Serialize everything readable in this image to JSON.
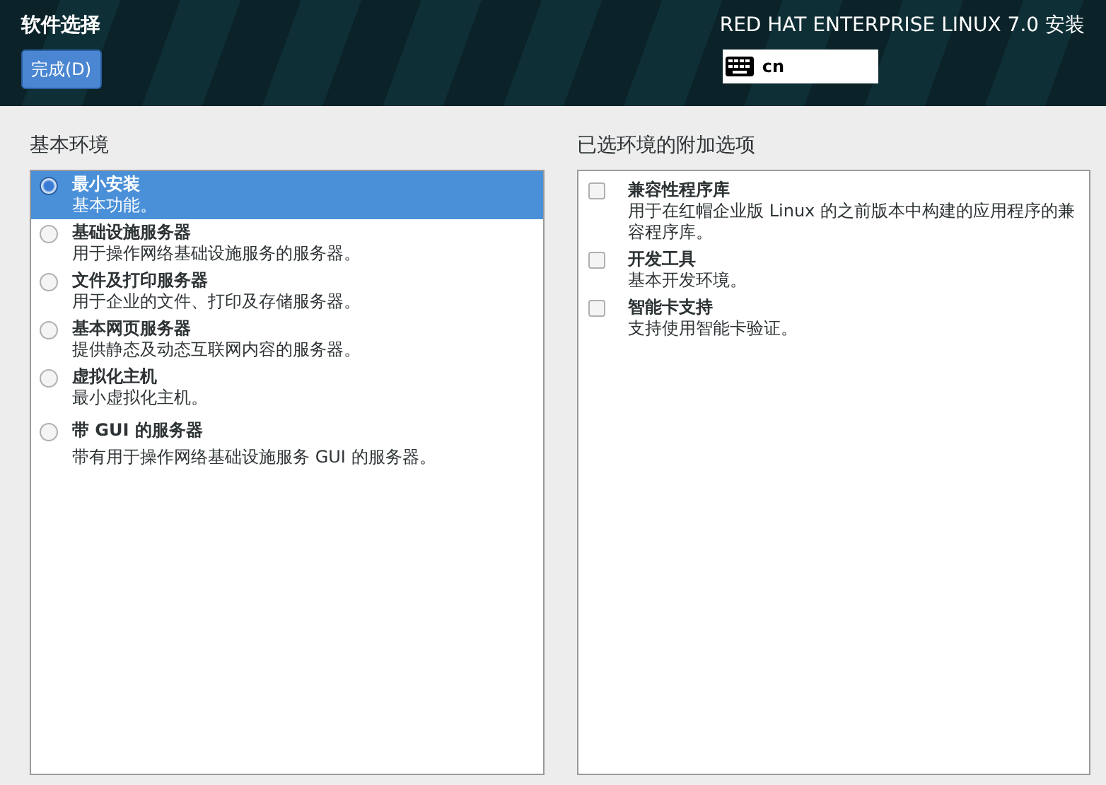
{
  "header": {
    "title": "软件选择",
    "done_button": "完成(D)",
    "product": "RED HAT ENTERPRISE LINUX 7.0 安装",
    "keyboard": "cn"
  },
  "base_environment": {
    "heading": "基本环境",
    "items": [
      {
        "name": "最小安装",
        "description": "基本功能。",
        "selected": true
      },
      {
        "name": "基础设施服务器",
        "description": "用于操作网络基础设施服务的服务器。",
        "selected": false
      },
      {
        "name": "文件及打印服务器",
        "description": "用于企业的文件、打印及存储服务器。",
        "selected": false
      },
      {
        "name": "基本网页服务器",
        "description": "提供静态及动态互联网内容的服务器。",
        "selected": false
      },
      {
        "name": "虚拟化主机",
        "description": "最小虚拟化主机。",
        "selected": false
      },
      {
        "name": "带 GUI 的服务器",
        "description": "带有用于操作网络基础设施服务 GUI 的服务器。",
        "selected": false
      }
    ]
  },
  "addons": {
    "heading": "已选环境的附加选项",
    "items": [
      {
        "name": "兼容性程序库",
        "description": "用于在红帽企业版 Linux 的之前版本中构建的应用程序的兼容程序库。",
        "checked": false
      },
      {
        "name": "开发工具",
        "description": "基本开发环境。",
        "checked": false
      },
      {
        "name": "智能卡支持",
        "description": "支持使用智能卡验证。",
        "checked": false
      }
    ]
  }
}
